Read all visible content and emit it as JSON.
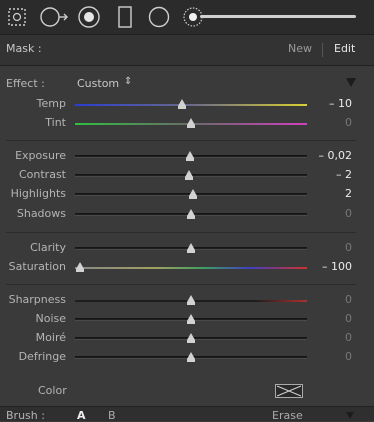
{
  "tools": [
    {
      "icon": "spot-removal-icon"
    },
    {
      "icon": "red-eye-icon"
    },
    {
      "icon": "graduated-filter-icon"
    },
    {
      "icon": "radial-filter-icon"
    },
    {
      "icon": "adjustment-brush-icon"
    }
  ],
  "mask": {
    "label": "Mask :",
    "new_label": "New",
    "edit_label": "Edit"
  },
  "effect": {
    "label": "Effect :",
    "value": "Custom",
    "stepper": "⇕"
  },
  "sliders": [
    {
      "label": "Temp",
      "value": "– 10",
      "pos": 0.46,
      "track": "temp",
      "active": true
    },
    {
      "label": "Tint",
      "value": "0",
      "pos": 0.5,
      "track": "tint",
      "active": false
    },
    {
      "label": "Exposure",
      "value": "– 0,02",
      "pos": 0.497,
      "track": "gray",
      "active": true
    },
    {
      "label": "Contrast",
      "value": "– 2",
      "pos": 0.49,
      "track": "gray",
      "active": true
    },
    {
      "label": "Highlights",
      "value": "2",
      "pos": 0.51,
      "track": "gray",
      "active": true
    },
    {
      "label": "Shadows",
      "value": "0",
      "pos": 0.5,
      "track": "gray",
      "active": false
    },
    {
      "label": "Clarity",
      "value": "0",
      "pos": 0.5,
      "track": "gray",
      "active": false
    },
    {
      "label": "Saturation",
      "value": "– 100",
      "pos": 0.02,
      "track": "saturation",
      "active": true
    },
    {
      "label": "Sharpness",
      "value": "0",
      "pos": 0.5,
      "track": "sharpness",
      "active": false
    },
    {
      "label": "Noise",
      "value": "0",
      "pos": 0.5,
      "track": "gray",
      "active": false
    },
    {
      "label": "Moiré",
      "value": "0",
      "pos": 0.5,
      "track": "gray",
      "active": false
    },
    {
      "label": "Defringe",
      "value": "0",
      "pos": 0.5,
      "track": "gray",
      "active": false
    }
  ],
  "color": {
    "label": "Color"
  },
  "brush": {
    "label": "Brush :",
    "a": "A",
    "b": "B",
    "erase": "Erase"
  },
  "colors": {
    "temp_left": "#2a3ed0",
    "temp_right": "#d8d030",
    "tint_left": "#30c040",
    "tint_right": "#d040c0",
    "sat_gray": "#888888",
    "sat_end": "#d03030",
    "sharp_red": "#b03030"
  }
}
